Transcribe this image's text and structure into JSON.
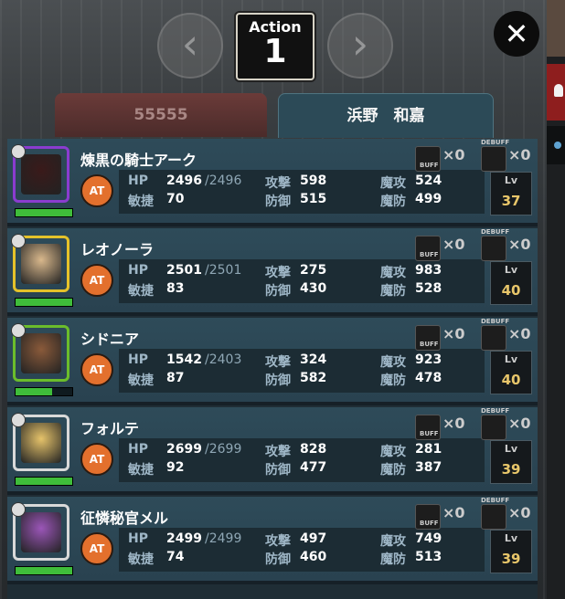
{
  "header": {
    "action_label": "Action",
    "action_number": "1",
    "prev_icon": "chevron-left-icon",
    "next_icon": "chevron-right-icon",
    "close_icon": "close-icon",
    "close_glyph": "✕",
    "prev_glyph": "‹",
    "next_glyph": "›"
  },
  "tabs": [
    {
      "label": "55555",
      "active": false
    },
    {
      "label": "浜野　和嘉",
      "active": true
    }
  ],
  "labels": {
    "hp": "HP",
    "speed": "敏捷",
    "atk": "攻撃",
    "def": "防御",
    "matk": "魔攻",
    "mdef": "魔防",
    "at": "AT",
    "lv": "Lv",
    "buff": "BUFF",
    "debuff": "DEBUFF",
    "count_prefix": "×0"
  },
  "units": [
    {
      "name": "煉黒の騎士アーク",
      "hp": "2496",
      "hp_max": "/2496",
      "speed": "70",
      "atk": "598",
      "def": "515",
      "matk": "524",
      "mdef": "499",
      "lv": "37",
      "hp_ratio": 1.0,
      "buff": "×0",
      "debuff": "×0"
    },
    {
      "name": "レオノーラ",
      "hp": "2501",
      "hp_max": "/2501",
      "speed": "83",
      "atk": "275",
      "def": "430",
      "matk": "983",
      "mdef": "528",
      "lv": "40",
      "hp_ratio": 1.0,
      "buff": "×0",
      "debuff": "×0"
    },
    {
      "name": "シドニア",
      "hp": "1542",
      "hp_max": "/2403",
      "speed": "87",
      "atk": "324",
      "def": "582",
      "matk": "923",
      "mdef": "478",
      "lv": "40",
      "hp_ratio": 0.64,
      "buff": "×0",
      "debuff": "×0"
    },
    {
      "name": "フォルテ",
      "hp": "2699",
      "hp_max": "/2699",
      "speed": "92",
      "atk": "828",
      "def": "477",
      "matk": "281",
      "mdef": "387",
      "lv": "39",
      "hp_ratio": 1.0,
      "buff": "×0",
      "debuff": "×0"
    },
    {
      "name": "征憐秘官メル",
      "hp": "2499",
      "hp_max": "/2499",
      "speed": "74",
      "atk": "497",
      "def": "460",
      "matk": "749",
      "mdef": "513",
      "lv": "39",
      "hp_ratio": 1.0,
      "buff": "×0",
      "debuff": "×0"
    }
  ],
  "colors": {
    "accent_orange": "#e3702d",
    "hp_green": "#3fbd3a",
    "lv_gold": "#e8c66a"
  }
}
